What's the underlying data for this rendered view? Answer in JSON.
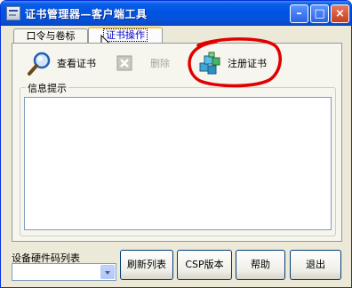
{
  "window": {
    "title": "证书管理器—客户端工具",
    "controls": {
      "minimize": "–",
      "maximize": "□",
      "close": "×"
    }
  },
  "tabs": [
    {
      "label": "口令与卷标",
      "active": false
    },
    {
      "label": "证书操作",
      "active": true
    }
  ],
  "toolbar": {
    "view_cert_label": "查看证书",
    "delete_label": "删除",
    "register_cert_label": "注册证书"
  },
  "info_group": {
    "label": "信息提示",
    "content": ""
  },
  "device_list": {
    "label": "设备硬件码列表",
    "selected": ""
  },
  "buttons": {
    "refresh": "刷新列表",
    "csp_version": "CSP版本",
    "help": "帮助",
    "exit": "退出"
  },
  "colors": {
    "titlebar": "#0055e5",
    "window_bg": "#ece9d8",
    "annotation_circle": "#e00000"
  },
  "icons": {
    "view_cert": "magnifier-icon",
    "delete": "delete-x-icon",
    "register_cert": "cubes-icon"
  }
}
